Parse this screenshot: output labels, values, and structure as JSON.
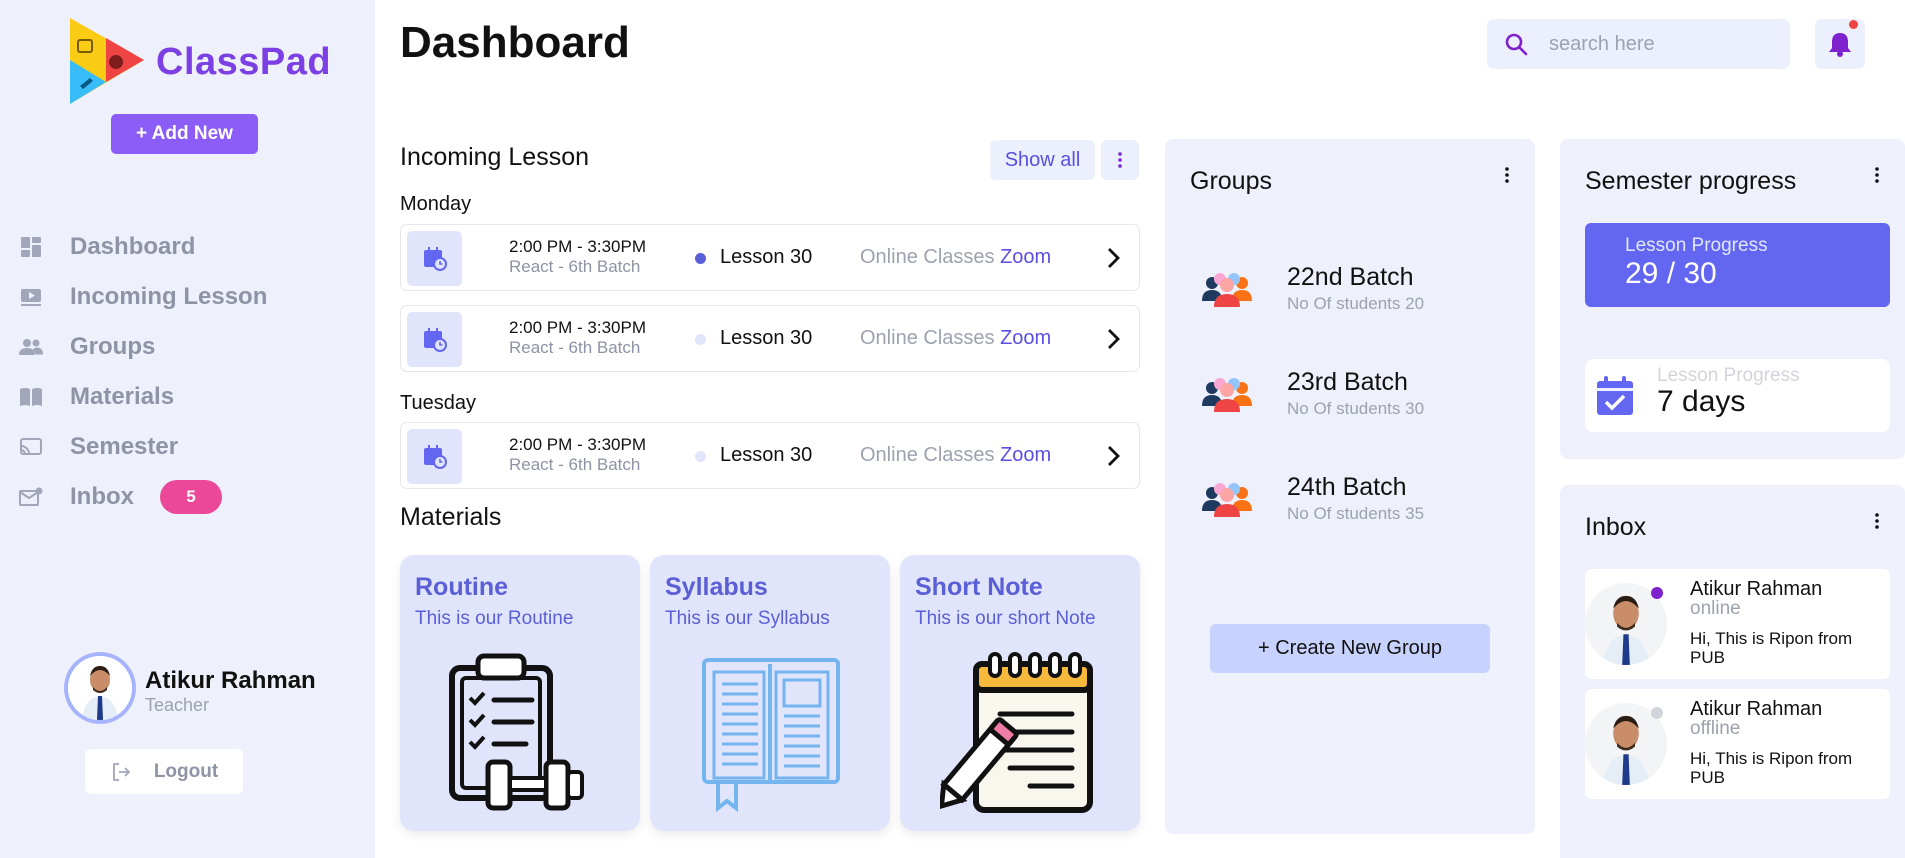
{
  "sidebar": {
    "brand": "ClassPad",
    "add_new_label": "+ Add New",
    "nav": [
      {
        "label": "Dashboard",
        "icon": "dashboard-icon"
      },
      {
        "label": "Incoming Lesson",
        "icon": "video-icon"
      },
      {
        "label": "Groups",
        "icon": "people-icon"
      },
      {
        "label": "Materials",
        "icon": "book-icon"
      },
      {
        "label": "Semester",
        "icon": "cast-icon"
      },
      {
        "label": "Inbox",
        "icon": "mail-icon",
        "badge": "5"
      }
    ],
    "user": {
      "name": "Atikur Rahman",
      "role": "Teacher"
    },
    "logout_label": "Logout"
  },
  "header": {
    "title": "Dashboard",
    "search_placeholder": "search here",
    "has_notification": true
  },
  "incoming": {
    "title": "Incoming Lesson",
    "show_all_label": "Show all",
    "days": [
      {
        "day": "Monday",
        "lessons": [
          {
            "time": "2:00 PM - 3:30PM",
            "batch": "React - 6th Batch",
            "name": "Lesson 30",
            "mode": "Online Classes",
            "platform": "Zoom",
            "active": true
          },
          {
            "time": "2:00 PM - 3:30PM",
            "batch": "React - 6th Batch",
            "name": "Lesson 30",
            "mode": "Online Classes",
            "platform": "Zoom",
            "active": false
          }
        ]
      },
      {
        "day": "Tuesday",
        "lessons": [
          {
            "time": "2:00 PM - 3:30PM",
            "batch": "React - 6th Batch",
            "name": "Lesson 30",
            "mode": "Online Classes",
            "platform": "Zoom",
            "active": false
          }
        ]
      }
    ]
  },
  "materials": {
    "title": "Materials",
    "cards": [
      {
        "title": "Routine",
        "desc": "This is our Routine",
        "illustration": "clipboard-fitness-icon"
      },
      {
        "title": "Syllabus",
        "desc": "This is our Syllabus",
        "illustration": "open-book-icon"
      },
      {
        "title": "Short Note",
        "desc": "This is our short Note",
        "illustration": "notepad-pencil-icon"
      }
    ]
  },
  "groups": {
    "title": "Groups",
    "items": [
      {
        "name": "22nd Batch",
        "students": "No Of students 20"
      },
      {
        "name": "23rd Batch",
        "students": "No Of students 30"
      },
      {
        "name": "24th Batch",
        "students": "No Of students 35"
      }
    ],
    "create_label": "+ Create New Group"
  },
  "semester": {
    "title": "Semester progress",
    "progress_label": "Lesson Progress",
    "progress_value": "29 / 30",
    "days_label": "Lesson Progress",
    "days_value": "7 days"
  },
  "inbox": {
    "title": "Inbox",
    "messages": [
      {
        "name": "Atikur Rahman",
        "status": "online",
        "text": "Hi, This is Ripon from PUB"
      },
      {
        "name": "Atikur Rahman",
        "status": "offline",
        "text": "Hi, This is Ripon from PUB"
      }
    ]
  },
  "colors": {
    "accent": "#8b5cf6",
    "primary": "#6366f1",
    "badge": "#ec4899",
    "online": "#7e22ce",
    "offline": "#d1d5db"
  }
}
